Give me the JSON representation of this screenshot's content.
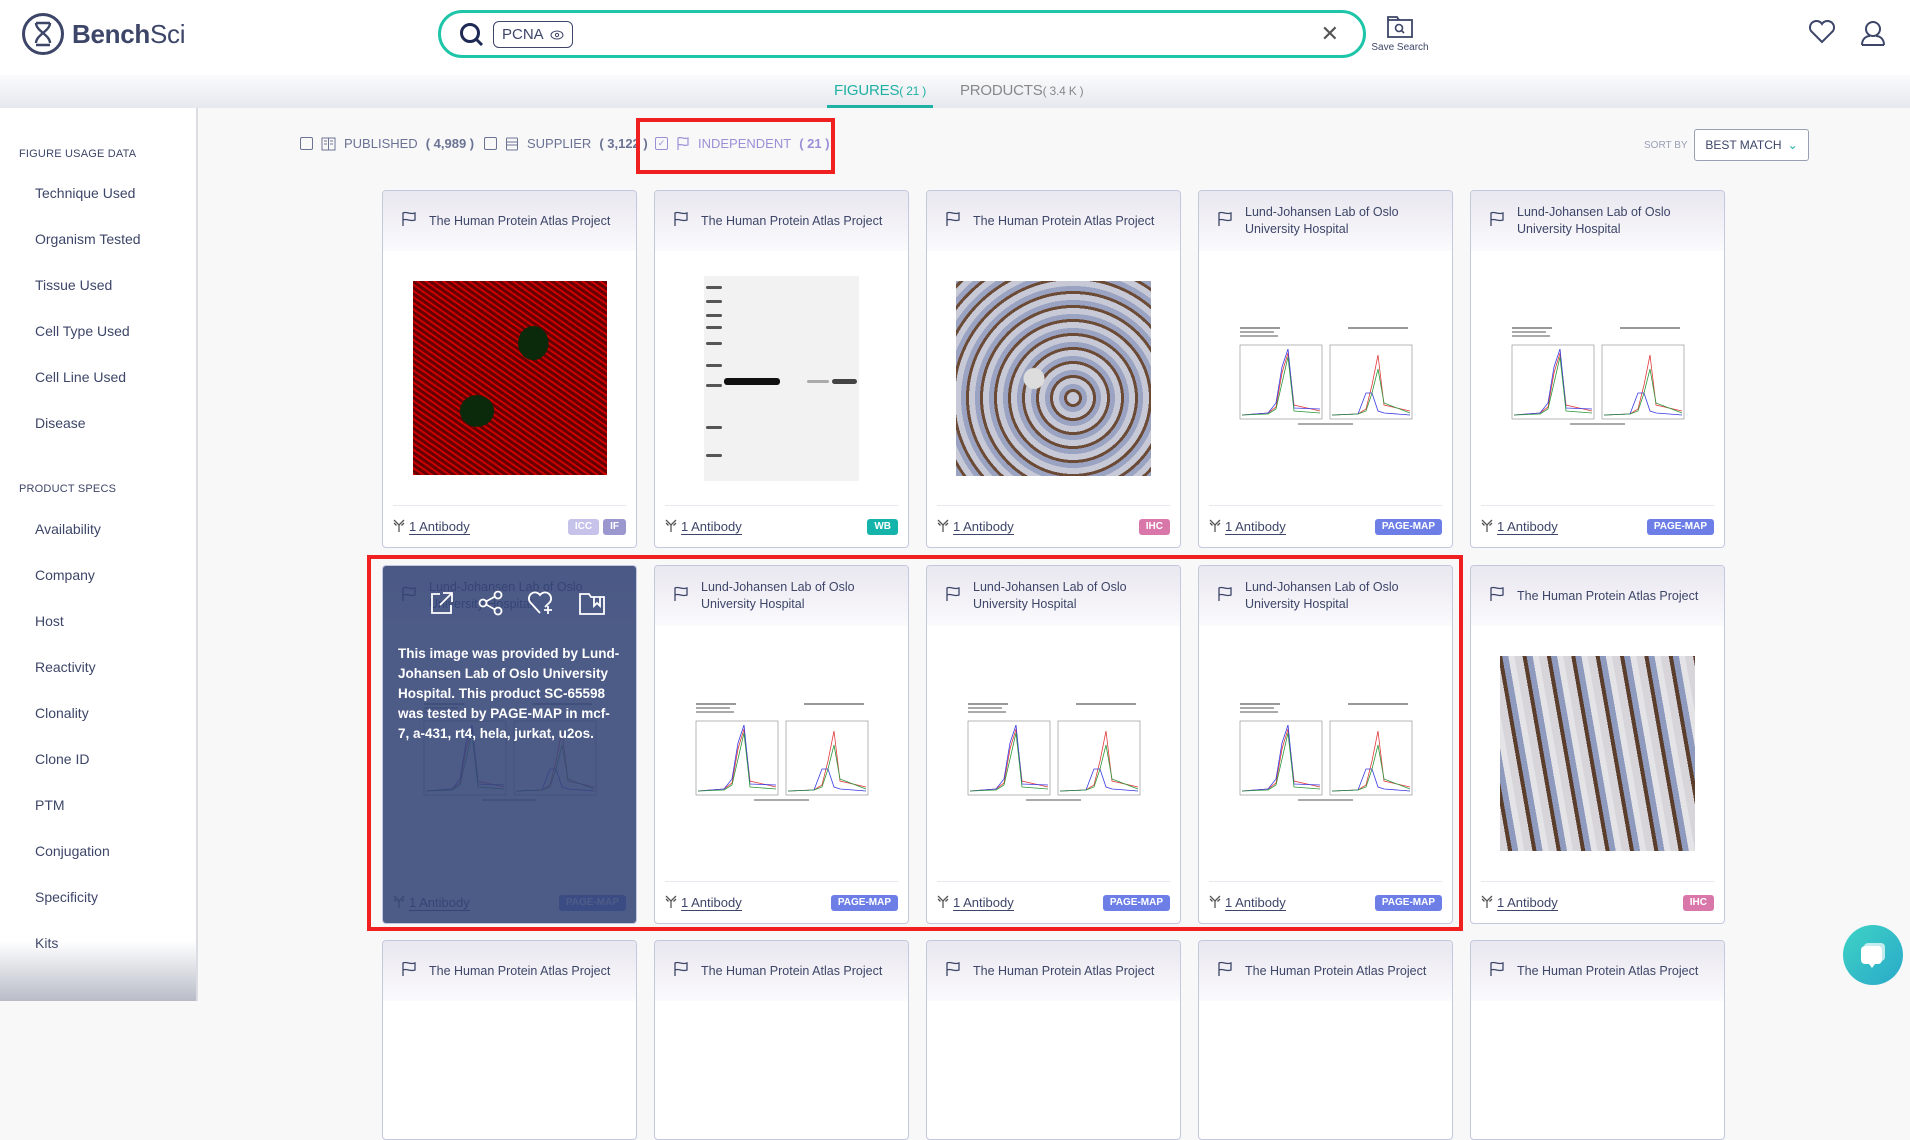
{
  "header": {
    "brand": {
      "bold": "Bench",
      "light": "Sci"
    },
    "search": {
      "chip": "PCNA",
      "value": "",
      "placeholder": ""
    },
    "save_search_label": "Save Search"
  },
  "tabs": [
    {
      "label": "FIGURES",
      "count": "( 21 )",
      "active": true
    },
    {
      "label": "PRODUCTS",
      "count": "( 3.4 K )",
      "active": false
    }
  ],
  "sidebar": {
    "sections": [
      {
        "title": "FIGURE USAGE DATA",
        "items": [
          "Technique Used",
          "Organism Tested",
          "Tissue Used",
          "Cell Type Used",
          "Cell Line Used",
          "Disease"
        ]
      },
      {
        "title": "PRODUCT SPECS",
        "items": [
          "Availability",
          "Company",
          "Host",
          "Reactivity",
          "Clonality",
          "Clone ID",
          "PTM",
          "Conjugation",
          "Specificity",
          "Kits"
        ]
      }
    ]
  },
  "filters": [
    {
      "label": "PUBLISHED",
      "count": "( 4,989 )",
      "checked": false,
      "icon": "book-icon"
    },
    {
      "label": "SUPPLIER",
      "count": "( 3,122 )",
      "checked": false,
      "icon": "store-icon"
    },
    {
      "label": "INDEPENDENT",
      "count": "( 21 )",
      "checked": true,
      "icon": "flag-icon"
    }
  ],
  "sort": {
    "label": "SORT BY",
    "value": "BEST MATCH"
  },
  "badge_colors": {
    "ICC": "#c5c3ea",
    "IF": "#9b97cf",
    "WB": "#15b4aa",
    "IHC": "#d977ab",
    "PAGE-MAP": "#6d7fe6"
  },
  "cards": [
    {
      "source": "The Human Protein Atlas Project",
      "image": "if",
      "antibody": "1 Antibody",
      "badges": [
        "ICC",
        "IF"
      ]
    },
    {
      "source": "The Human Protein Atlas Project",
      "image": "wb",
      "antibody": "1 Antibody",
      "badges": [
        "WB"
      ]
    },
    {
      "source": "The Human Protein Atlas Project",
      "image": "ihc",
      "antibody": "1 Antibody",
      "badges": [
        "IHC"
      ]
    },
    {
      "source": "Lund-Johansen Lab of Oslo University Hospital",
      "image": "chart",
      "antibody": "1 Antibody",
      "badges": [
        "PAGE-MAP"
      ]
    },
    {
      "source": "Lund-Johansen Lab of Oslo University Hospital",
      "image": "chart",
      "antibody": "1 Antibody",
      "badges": [
        "PAGE-MAP"
      ]
    },
    {
      "source": "Lund-Johansen Lab of Oslo University Hospital",
      "image": "chart",
      "antibody": "1 Antibody",
      "badges": [
        "PAGE-MAP"
      ],
      "hover": true,
      "overlay_text": "This image was provided by Lund-Johansen Lab of Oslo University Hospital. This product SC-65598 was tested by PAGE-MAP in mcf-7, a-431, rt4, hela, jurkat, u2os."
    },
    {
      "source": "Lund-Johansen Lab of Oslo University Hospital",
      "image": "chart",
      "antibody": "1 Antibody",
      "badges": [
        "PAGE-MAP"
      ]
    },
    {
      "source": "Lund-Johansen Lab of Oslo University Hospital",
      "image": "chart",
      "antibody": "1 Antibody",
      "badges": [
        "PAGE-MAP"
      ]
    },
    {
      "source": "Lund-Johansen Lab of Oslo University Hospital",
      "image": "chart",
      "antibody": "1 Antibody",
      "badges": [
        "PAGE-MAP"
      ]
    },
    {
      "source": "The Human Protein Atlas Project",
      "image": "ihc-b",
      "antibody": "1 Antibody",
      "badges": [
        "IHC"
      ]
    },
    {
      "source": "The Human Protein Atlas Project",
      "image": "",
      "antibody": "",
      "badges": []
    },
    {
      "source": "The Human Protein Atlas Project",
      "image": "",
      "antibody": "",
      "badges": []
    },
    {
      "source": "The Human Protein Atlas Project",
      "image": "",
      "antibody": "",
      "badges": []
    },
    {
      "source": "The Human Protein Atlas Project",
      "image": "",
      "antibody": "",
      "badges": []
    },
    {
      "source": "The Human Protein Atlas Project",
      "image": "",
      "antibody": "",
      "badges": []
    }
  ],
  "accent_color": "#1fb0a4",
  "highlight_color": "#f02020"
}
